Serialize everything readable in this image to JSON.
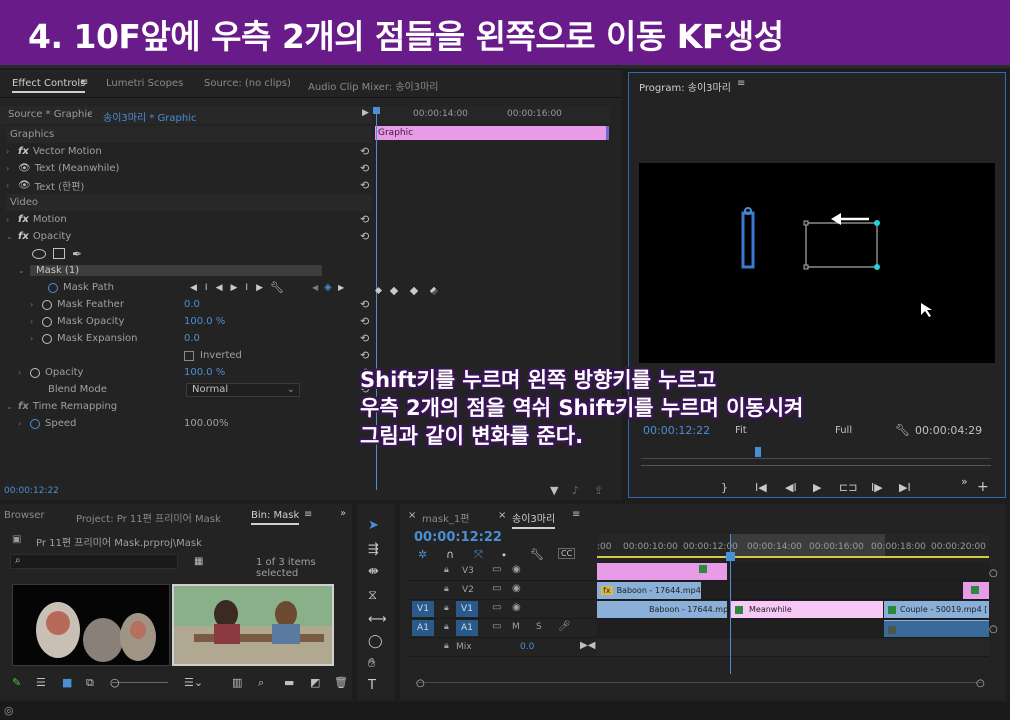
{
  "title": "4. 10F앞에 우측 2개의 점들을 왼쪽으로 이동  KF생성",
  "effect_controls": {
    "tabs": [
      "Effect Controls",
      "Lumetri Scopes",
      "Source: (no clips)",
      "Audio Clip Mixer: 송이3마리"
    ],
    "source_label": "Source * Graphic",
    "sequence_label": "송이3마리 * Graphic",
    "ruler": [
      "00:00:14:00",
      "00:00:16:00"
    ],
    "graphic_clip_label": "Graphic",
    "rows": {
      "graphics": "Graphics",
      "vector_motion": "Vector Motion",
      "text_meanwhile": "Text (Meanwhile)",
      "text_hanpyeon": "Text (한편)",
      "video": "Video",
      "motion": "Motion",
      "opacity": "Opacity",
      "mask": "Mask (1)",
      "mask_path": "Mask Path",
      "mask_feather": "Mask Feather",
      "mask_feather_val": "0.0",
      "mask_opacity": "Mask Opacity",
      "mask_opacity_val": "100.0 %",
      "mask_expansion": "Mask Expansion",
      "mask_expansion_val": "0.0",
      "inverted": "Inverted",
      "opacity2": "Opacity",
      "opacity2_val": "100.0 %",
      "blend_mode": "Blend Mode",
      "blend_mode_val": "Normal",
      "time_remapping": "Time Remapping",
      "speed": "Speed",
      "speed_val": "100.00%"
    },
    "timecode": "00:00:12:22"
  },
  "program": {
    "title": "Program: 송이3마리",
    "timecode": "00:00:12:22",
    "fit": "Fit",
    "full": "Full",
    "duration": "00:00:04:29"
  },
  "project": {
    "tabs": [
      "Browser",
      "Project: Pr 11편 프리미어 Mask",
      "Bin: Mask"
    ],
    "path": "Pr 11편 프리미어 Mask.prproj\\Mask",
    "items_selected": "1 of 3 items selected"
  },
  "timeline": {
    "tabs": [
      "mask_1편",
      "송이3마리"
    ],
    "timecode": "00:00:12:22",
    "ruler": [
      ":00",
      "00:00:10:00",
      "00:00:12:00",
      "00:00:14:00",
      "00:00:16:00",
      "00:00:18:00",
      "00:00:20:00"
    ],
    "tracks": {
      "v3": "V3",
      "v2": "V2",
      "v1": "V1",
      "a1": "A1",
      "v1_src": "V1",
      "a1_src": "A1",
      "mix": "Mix",
      "mix_val": "0.0"
    },
    "clips": {
      "baboon_v2": "Baboon - 17644.mp4",
      "baboon_v1": "Baboon - 17644.mp4",
      "meanwhile": "Meanwhile",
      "couple": "Couple - 50019.mp4 ["
    }
  },
  "caption": {
    "line1": "Shift키를 누르며 왼쪽 방향키를 누르고",
    "line2": "우측 2개의 점을 역쉬 Shift키를 누르며 이동시켜",
    "line3": "그림과 같이  변화를 준다."
  },
  "colors": {
    "title_bg": "#6a1b8a",
    "accent_blue": "#4a8fd4",
    "graphic_pink": "#e89be6",
    "clip_blue": "#8ab0d9",
    "mask_cyan": "#21d4d9"
  }
}
